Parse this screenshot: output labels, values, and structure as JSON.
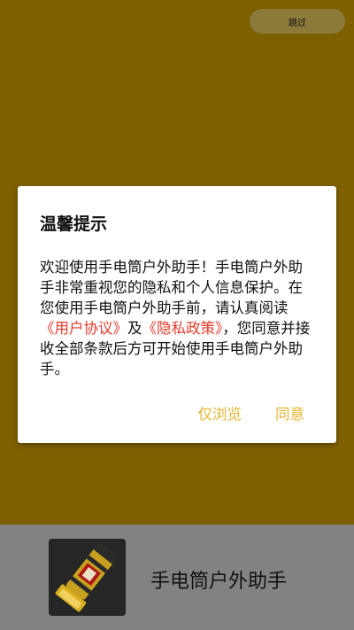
{
  "skip_label": "跳过",
  "dialog": {
    "title": "温馨提示",
    "body_part1": "欢迎使用手电筒户外助手！手电筒户外助手非常重视您的隐私和个人信息保护。在您使用手电筒户外助手前，请认真阅读",
    "link_user_agreement": "《用户协议》",
    "body_and": "及",
    "link_privacy_policy": "《隐私政策》",
    "body_part2": "，您同意并接收全部条款后方可开始使用手电筒户外助手。",
    "browse_only_label": "仅浏览",
    "agree_label": "同意"
  },
  "bottom": {
    "app_name": "手电筒户外助手",
    "icon_name": "flashlight-icon"
  },
  "colors": {
    "background": "#7f6000",
    "accent": "#e8b430",
    "link": "#e53a2a",
    "bottom_bar": "#828282"
  }
}
